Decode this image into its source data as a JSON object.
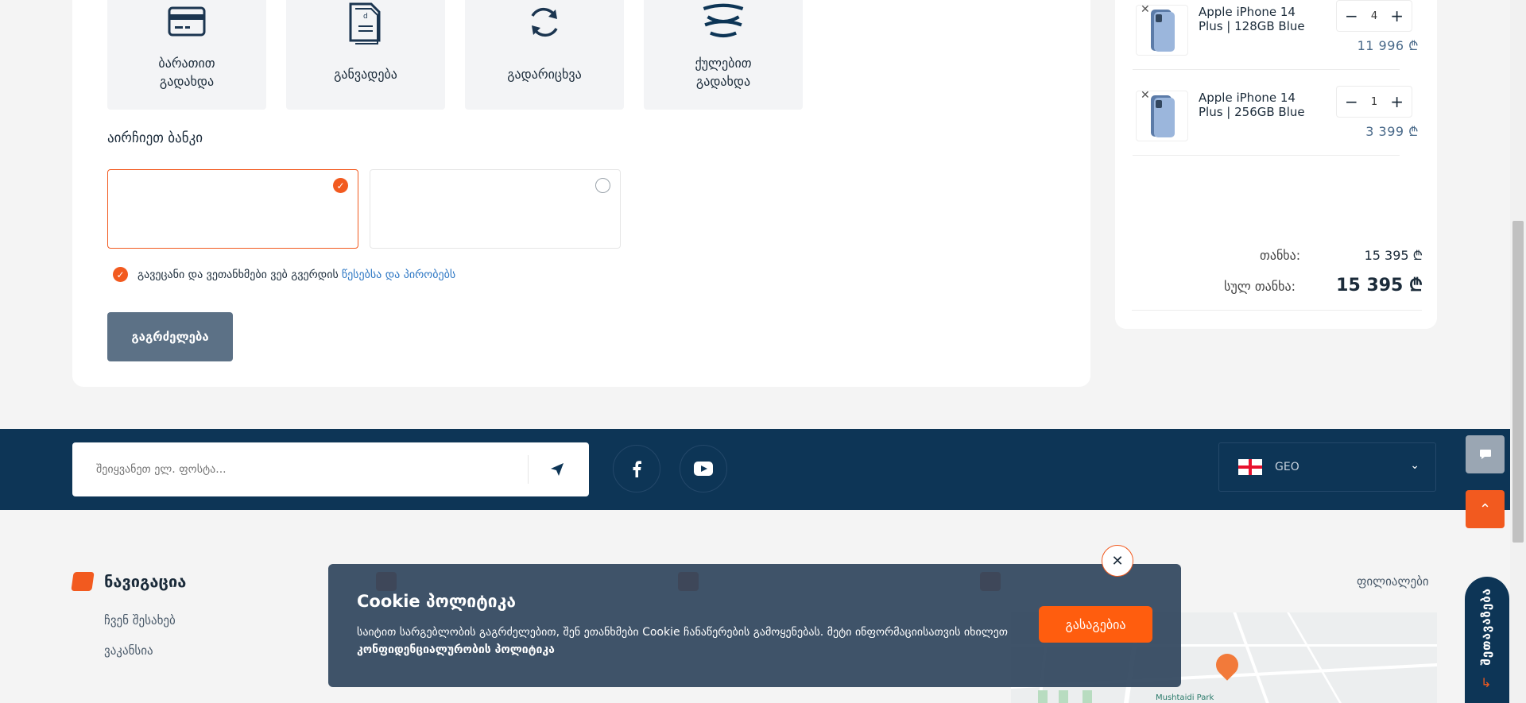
{
  "payment_methods": [
    {
      "label": "ბარათით გადახდა",
      "icon": "credit-card-icon"
    },
    {
      "label": "განვადება",
      "icon": "document-icon"
    },
    {
      "label": "გადარიცხვა",
      "icon": "refresh-icon"
    },
    {
      "label": "ქულებით გადახდა",
      "icon": "points-logo-icon"
    }
  ],
  "bank_section": {
    "title": "აირჩიეთ ბანკი"
  },
  "terms": {
    "text": "გავეცანი და ვეთანხმები ვებ გვერდის",
    "link": "წესებსა და პირობებს"
  },
  "continue_label": "გაგრძელება",
  "cart": {
    "items": [
      {
        "name": "Apple iPhone 14 Plus | 128GB Blue",
        "qty": "4",
        "price": "11 996 ₾"
      },
      {
        "name": "Apple iPhone 14 Plus | 256GB Blue",
        "qty": "1",
        "price": "3 399 ₾"
      }
    ],
    "subtotal_label": "თანხა:",
    "subtotal_value": "15 395 ₾",
    "total_label": "სულ თანხა:",
    "total_value": "15 395 ₾"
  },
  "newsletter": {
    "placeholder": "შეიყვანეთ ელ. ფოსტა..."
  },
  "language": {
    "code": "GEO"
  },
  "side_tab": {
    "label": "შეთავაზება"
  },
  "footer": {
    "nav_title": "ნავიგაცია",
    "nav_links": [
      "ჩვენ შესახებ",
      "ვაკანსია"
    ],
    "branches_label": "ფილიალები",
    "map_park_label": "Mushtaidi Park"
  },
  "cookie": {
    "title": "Cookie პოლიტიკა",
    "text": "საიტით სარგებლობის გაგრძელებით, შენ ეთანხმები Cookie ჩანაწერების გამოყენებას. მეტი ინფორმაციისათვის იხილეთ",
    "link": "კონფიდენციალურობის პოლიტიკა",
    "accept_label": "გასაგებია"
  },
  "colors": {
    "accent": "#f25a1f",
    "footer": "#0d3556",
    "button": "#5c7186",
    "link": "#2d77c4"
  }
}
